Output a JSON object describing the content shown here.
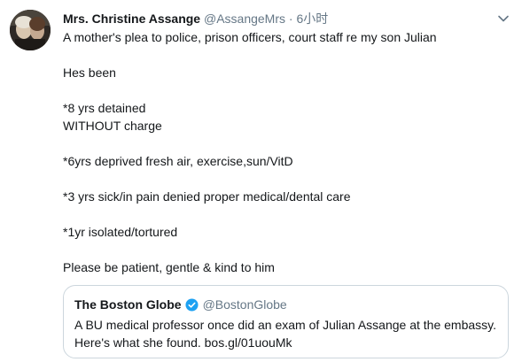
{
  "tweet": {
    "display_name": "Mrs. Christine Assange",
    "handle": "@AssangeMrs",
    "separator": "·",
    "time": "6小时",
    "lines": [
      "A mother's plea to police, prison officers, court staff re my son Julian",
      "",
      "Hes been",
      "",
      "*8 yrs detained",
      "WITHOUT charge",
      "",
      "*6yrs deprived fresh air, exercise,sun/VitD",
      "",
      "*3 yrs sick/in pain denied proper medical/dental care",
      "",
      "*1yr isolated/tortured",
      "",
      "Please be patient, gentle & kind to him"
    ]
  },
  "quoted": {
    "display_name": "The Boston Globe",
    "handle": "@BostonGlobe",
    "line1": "A BU medical professor once did an exam of Julian Assange at the embassy.",
    "line2": "Here's what she found. bos.gl/01uouMk"
  },
  "colors": {
    "text": "#14171a",
    "secondary": "#657786",
    "border": "#ccd6dd",
    "verified": "#1da1f2"
  },
  "icons": {
    "avatar": "profile-photo",
    "caret": "chevron-down-icon",
    "verified": "verified-badge-icon"
  }
}
